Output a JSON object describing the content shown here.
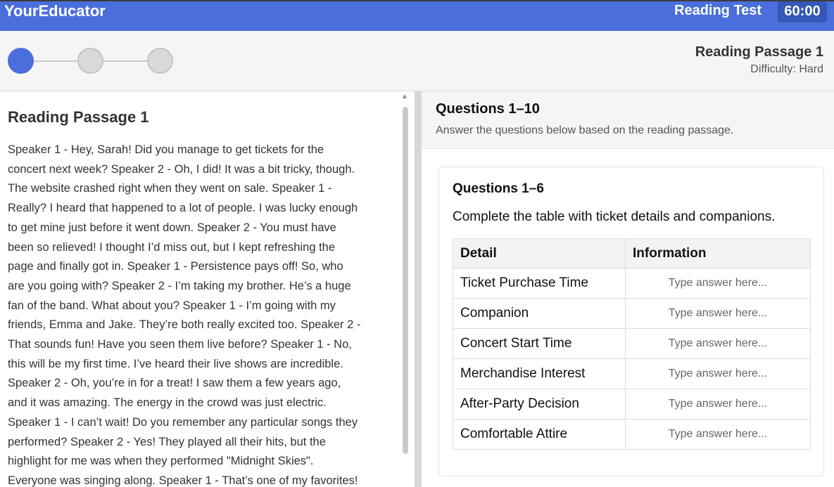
{
  "app": {
    "brand": "YourEducator",
    "test_name": "Reading Test",
    "timer": "60:00"
  },
  "progress": {
    "steps": [
      {
        "state": "active"
      },
      {
        "state": "inactive"
      },
      {
        "state": "inactive"
      }
    ],
    "passage_title": "Reading Passage 1",
    "difficulty": "Difficulty: Hard"
  },
  "passage": {
    "title": "Reading Passage 1",
    "lines": [
      "Speaker 1 - Hey, Sarah! Did you manage to get tickets for the",
      "concert next week? Speaker 2 - Oh, I did! It was a bit tricky, though.",
      "The website crashed right when they went on sale. Speaker 1 -",
      "Really? I heard that happened to a lot of people. I was lucky enough",
      "to get mine just before it went down. Speaker 2 - You must have",
      "been so relieved! I thought I’d miss out, but I kept refreshing the",
      "page and finally got in. Speaker 1 - Persistence pays off! So, who",
      "are you going with? Speaker 2 - I’m taking my brother. He’s a huge",
      "fan of the band. What about you? Speaker 1 - I’m going with my",
      "friends, Emma and Jake. They’re both really excited too. Speaker 2 -",
      "That sounds fun! Have you seen them live before? Speaker 1 - No,",
      "this will be my first time. I’ve heard their live shows are incredible.",
      "Speaker 2 - Oh, you’re in for a treat! I saw them a few years ago,",
      "and it was amazing. The energy in the crowd was just electric.",
      "Speaker 1 - I can’t wait! Do you remember any particular songs they",
      "performed? Speaker 2 - Yes! They played all their hits, but the",
      "highlight for me was when they performed \"Midnight Skies\".",
      "Everyone was singing along. Speaker 1 - That’s one of my favorites!"
    ]
  },
  "questions": {
    "header_title": "Questions 1–10",
    "header_subtitle": "Answer the questions below based on the reading passage.",
    "group": {
      "title": "Questions 1–6",
      "instruction": "Complete the table with ticket details and companions.",
      "columns": [
        "Detail",
        "Information"
      ],
      "rows": [
        {
          "detail": "Ticket Purchase Time",
          "placeholder": "Type answer here...",
          "value": ""
        },
        {
          "detail": "Companion",
          "placeholder": "Type answer here...",
          "value": ""
        },
        {
          "detail": "Concert Start Time",
          "placeholder": "Type answer here...",
          "value": ""
        },
        {
          "detail": "Merchandise Interest",
          "placeholder": "Type answer here...",
          "value": ""
        },
        {
          "detail": "After-Party Decision",
          "placeholder": "Type answer here...",
          "value": ""
        },
        {
          "detail": "Comfortable Attire",
          "placeholder": "Type answer here...",
          "value": ""
        }
      ]
    }
  },
  "colors": {
    "brand_blue": "#4a6fdc",
    "timer_bg": "#3457b8",
    "step_inactive": "#d9d9d9"
  }
}
